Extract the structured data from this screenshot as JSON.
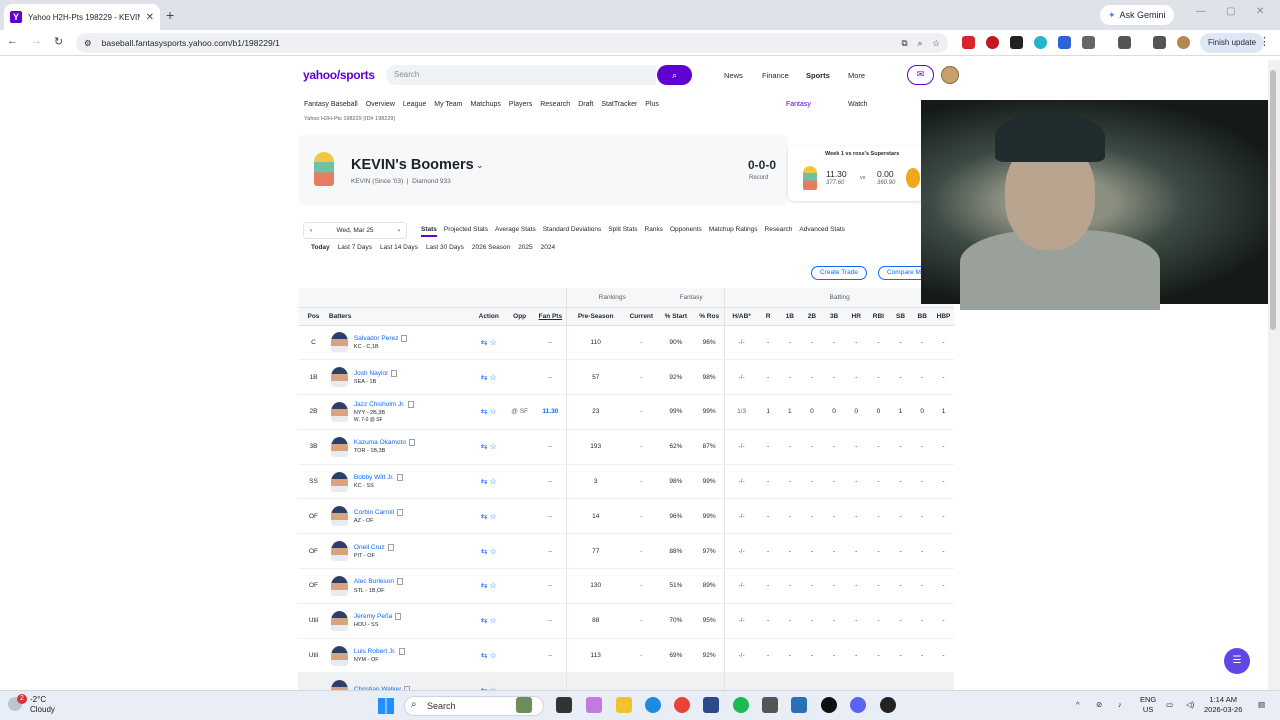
{
  "browser": {
    "tab_title": "Yahoo H2H-Pts 198229 - KEVIN",
    "url": "baseball.fantasysports.yahoo.com/b1/198229/1",
    "ask_gemini": "Ask Gemini",
    "finish_update": "Finish update"
  },
  "yahoo": {
    "logo": "yahoo/sports",
    "search_placeholder": "Search",
    "nav": [
      "News",
      "Finance",
      "Sports",
      "More"
    ]
  },
  "subnav": [
    "Fantasy Baseball",
    "Overview",
    "League",
    "My Team",
    "Matchups",
    "Players",
    "Research",
    "Draft",
    "StatTracker",
    "Plus"
  ],
  "subnav_right": {
    "fantasy": "Fantasy",
    "watch": "Watch"
  },
  "league_label": "Yahoo H2H-Pts 198229 (ID# 198229)",
  "team": {
    "name": "KEVIN's Boomers",
    "owner": "KEVIN (Since '03)",
    "tier": "Diamond 933",
    "record": "0-0-0",
    "record_label": "Record"
  },
  "matchup": {
    "title": "Week 1 vs ross's Superstars",
    "my_score": "11.30",
    "my_proj": "377.60",
    "vs": "vs",
    "opp_score": "0.00",
    "opp_proj": "360.90"
  },
  "date": {
    "label": "Wed, Mar 25"
  },
  "stat_tabs": [
    "Stats",
    "Projected Stats",
    "Average Stats",
    "Standard Deviations",
    "Split Stats",
    "Ranks",
    "Opponents",
    "Matchup Ratings",
    "Research",
    "Advanced Stats"
  ],
  "ranges": [
    "Today",
    "Last 7 Days",
    "Last 14 Days",
    "Last 30 Days",
    "2026 Season",
    "2025",
    "2024"
  ],
  "buttons": {
    "create_trade": "Create Trade",
    "compare": "Compare M"
  },
  "table": {
    "groups": {
      "rankings": "Rankings",
      "fantasy": "Fantasy",
      "batting": "Batting"
    },
    "headers": [
      "Pos",
      "Batters",
      "Action",
      "Opp",
      "Fan Pts",
      "Pre-Season",
      "Current",
      "% Start",
      "% Ros",
      "H/AB*",
      "R",
      "1B",
      "2B",
      "3B",
      "HR",
      "RBI",
      "SB",
      "BB",
      "HBP"
    ],
    "rows": [
      {
        "pos": "C",
        "name": "Salvador Perez",
        "meta": "KC - C,1B",
        "game": "",
        "opp": "",
        "fp": "–",
        "pre": "110",
        "cur": "-",
        "start": "90%",
        "ros": "96%",
        "hab": "-/-",
        "stats": [
          "-",
          "-",
          "-",
          "-",
          "-",
          "-",
          "-",
          "-",
          "-"
        ]
      },
      {
        "pos": "1B",
        "name": "Josh Naylor",
        "meta": "SEA - 1B",
        "game": "",
        "opp": "",
        "fp": "–",
        "pre": "57",
        "cur": "-",
        "start": "92%",
        "ros": "98%",
        "hab": "-/-",
        "stats": [
          "-",
          "-",
          "-",
          "-",
          "-",
          "-",
          "-",
          "-",
          "-"
        ]
      },
      {
        "pos": "2B",
        "name": "Jazz Chisholm Jr.",
        "meta": "NYY - 2B,3B",
        "game": "W, 7-0 @ SF",
        "opp": "@ SF",
        "fp": "11.30",
        "pre": "23",
        "cur": "-",
        "start": "99%",
        "ros": "99%",
        "hab": "1/3",
        "stats": [
          "1",
          "1",
          "0",
          "0",
          "0",
          "0",
          "1",
          "0",
          "1"
        ]
      },
      {
        "pos": "3B",
        "name": "Kazuma Okamoto",
        "meta": "TOR - 1B,3B",
        "game": "",
        "opp": "",
        "fp": "–",
        "pre": "193",
        "cur": "-",
        "start": "62%",
        "ros": "87%",
        "hab": "-/-",
        "stats": [
          "-",
          "-",
          "-",
          "-",
          "-",
          "-",
          "-",
          "-",
          "-"
        ]
      },
      {
        "pos": "SS",
        "name": "Bobby Witt Jr.",
        "meta": "KC - SS",
        "game": "",
        "opp": "",
        "fp": "–",
        "pre": "3",
        "cur": "-",
        "start": "98%",
        "ros": "99%",
        "hab": "-/-",
        "stats": [
          "-",
          "-",
          "-",
          "-",
          "-",
          "-",
          "-",
          "-",
          "-"
        ]
      },
      {
        "pos": "OF",
        "name": "Corbin Carroll",
        "meta": "AZ - OF",
        "game": "",
        "opp": "",
        "fp": "–",
        "pre": "14",
        "cur": "-",
        "start": "96%",
        "ros": "99%",
        "hab": "-/-",
        "stats": [
          "-",
          "-",
          "-",
          "-",
          "-",
          "-",
          "-",
          "-",
          "-"
        ]
      },
      {
        "pos": "OF",
        "name": "Oneil Cruz",
        "meta": "PIT - OF",
        "game": "",
        "opp": "",
        "fp": "–",
        "pre": "77",
        "cur": "-",
        "start": "88%",
        "ros": "97%",
        "hab": "-/-",
        "stats": [
          "-",
          "-",
          "-",
          "-",
          "-",
          "-",
          "-",
          "-",
          "-"
        ]
      },
      {
        "pos": "OF",
        "name": "Alec Burleson",
        "meta": "STL - 1B,OF",
        "game": "",
        "opp": "",
        "fp": "–",
        "pre": "130",
        "cur": "-",
        "start": "51%",
        "ros": "89%",
        "hab": "-/-",
        "stats": [
          "-",
          "-",
          "-",
          "-",
          "-",
          "-",
          "-",
          "-",
          "-"
        ]
      },
      {
        "pos": "Util",
        "name": "Jeremy Peña",
        "meta": "HOU - SS",
        "game": "",
        "opp": "",
        "fp": "–",
        "pre": "88",
        "cur": "-",
        "start": "70%",
        "ros": "95%",
        "hab": "-/-",
        "stats": [
          "-",
          "-",
          "-",
          "-",
          "-",
          "-",
          "-",
          "-",
          "-"
        ]
      },
      {
        "pos": "Util",
        "name": "Luis Robert Jr.",
        "meta": "NYM - OF",
        "game": "",
        "opp": "",
        "fp": "–",
        "pre": "113",
        "cur": "-",
        "start": "69%",
        "ros": "92%",
        "hab": "-/-",
        "stats": [
          "-",
          "-",
          "-",
          "-",
          "-",
          "-",
          "-",
          "-",
          "-"
        ]
      },
      {
        "pos": "",
        "name": "Christian Walker",
        "meta": "",
        "game": "",
        "opp": "",
        "fp": "",
        "pre": "",
        "cur": "",
        "start": "",
        "ros": "",
        "hab": "",
        "stats": [
          "",
          "",
          "",
          "",
          "",
          "",
          "",
          "",
          ""
        ]
      }
    ]
  },
  "taskbar": {
    "temp": "-2°C",
    "cond": "Cloudy",
    "badge": "2",
    "search": "Search",
    "lang1": "ENG",
    "lang2": "US",
    "time": "1:14 AM",
    "date": "2026-03-26"
  },
  "colors": {
    "yahoo_purple": "#6001d2",
    "link_blue": "#0f69ff"
  }
}
